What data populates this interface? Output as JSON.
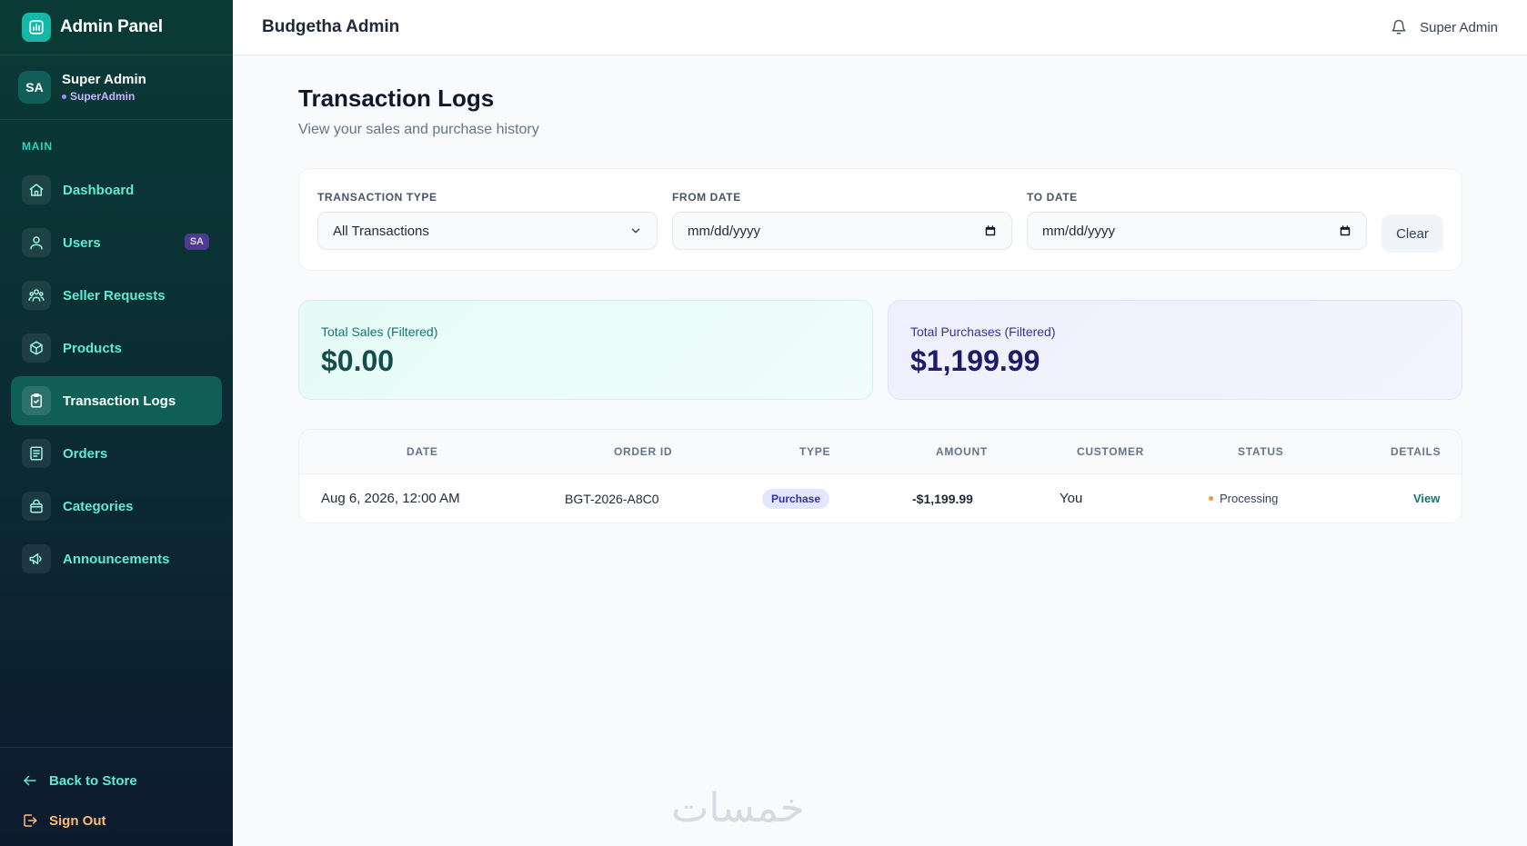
{
  "sidebar": {
    "brand_title": "Admin Panel",
    "user": {
      "initials": "SA",
      "name": "Super Admin",
      "role": "SuperAdmin"
    },
    "section_label": "MAIN",
    "items": [
      {
        "label": "Dashboard",
        "icon": "home-icon"
      },
      {
        "label": "Users",
        "icon": "users-icon",
        "badge": "SA"
      },
      {
        "label": "Seller Requests",
        "icon": "group-icon"
      },
      {
        "label": "Products",
        "icon": "box-icon"
      },
      {
        "label": "Transaction Logs",
        "icon": "clipboard-check-icon",
        "active": true
      },
      {
        "label": "Orders",
        "icon": "list-icon"
      },
      {
        "label": "Categories",
        "icon": "bag-icon"
      },
      {
        "label": "Announcements",
        "icon": "megaphone-icon"
      }
    ],
    "back_label": "Back to Store",
    "signout_label": "Sign Out"
  },
  "topbar": {
    "title": "Budgetha Admin",
    "user_name": "Super Admin"
  },
  "page": {
    "title": "Transaction Logs",
    "subtitle": "View your sales and purchase history"
  },
  "filters": {
    "type_label": "TRANSACTION TYPE",
    "type_value": "All Transactions",
    "from_label": "FROM DATE",
    "from_value": "mm/dd/yyyy",
    "to_label": "TO DATE",
    "to_value": "mm/dd/yyyy",
    "clear_label": "Clear"
  },
  "summary": {
    "sales_label": "Total Sales (Filtered)",
    "sales_value": "$0.00",
    "purchases_label": "Total Purchases (Filtered)",
    "purchases_value": "$1,199.99"
  },
  "table": {
    "headers": [
      "DATE",
      "ORDER ID",
      "TYPE",
      "AMOUNT",
      "CUSTOMER",
      "STATUS",
      "DETAILS"
    ],
    "rows": [
      {
        "date": "Aug 6, 2026, 12:00 AM",
        "order_id": "BGT-2026-A8C0",
        "type": "Purchase",
        "amount": "-$1,199.99",
        "customer": "You",
        "status": "Processing",
        "details": "View"
      }
    ]
  },
  "colors": {
    "sidebar_bg": "#0a3b36",
    "accent": "#14b8a6",
    "active_nav": "#0f5f57",
    "status_processing": "#fb923c"
  },
  "watermark": "خمسات"
}
